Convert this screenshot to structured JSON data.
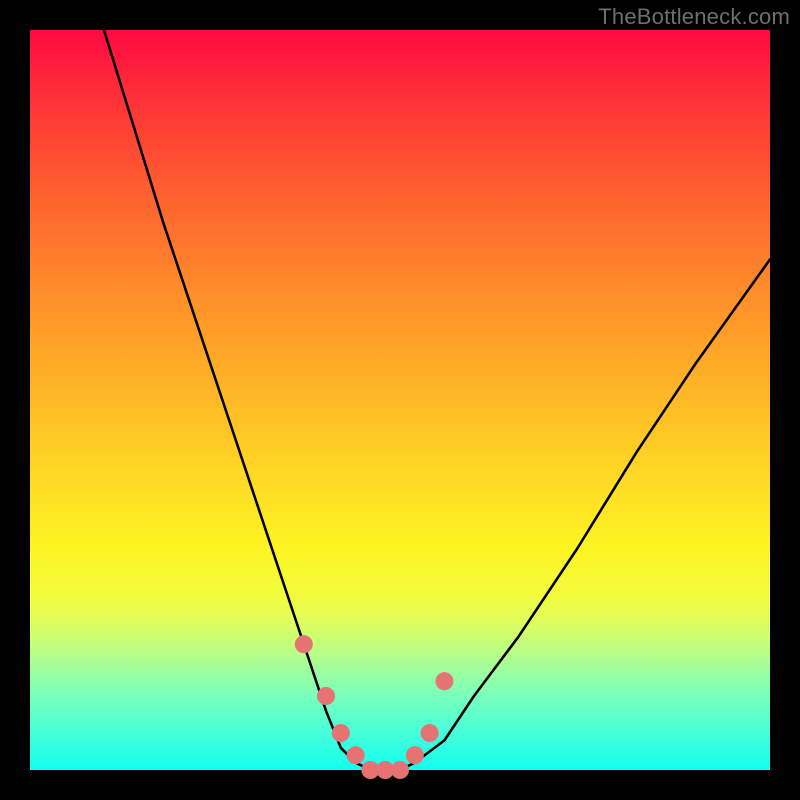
{
  "watermark": "TheBottleneck.com",
  "chart_data": {
    "type": "line",
    "title": "",
    "xlabel": "",
    "ylabel": "",
    "xlim": [
      0,
      100
    ],
    "ylim": [
      0,
      100
    ],
    "grid": false,
    "legend": false,
    "series": [
      {
        "name": "bottleneck-curve",
        "color": "#000000",
        "x": [
          10,
          14,
          18,
          22,
          26,
          30,
          34,
          36,
          38,
          40,
          42,
          44,
          46,
          48,
          50,
          52,
          56,
          60,
          66,
          74,
          82,
          90,
          100
        ],
        "y": [
          100,
          87,
          74,
          62,
          50,
          38,
          26,
          20,
          14,
          8,
          3,
          1,
          0,
          0,
          0,
          1,
          4,
          10,
          18,
          30,
          43,
          55,
          69
        ]
      }
    ],
    "markers": [
      {
        "name": "highlight-dots",
        "color": "#e57373",
        "radius": 9,
        "x": [
          37,
          40,
          42,
          44,
          46,
          48,
          50,
          52,
          54,
          56
        ],
        "y": [
          17,
          10,
          5,
          2,
          0,
          0,
          0,
          2,
          5,
          12
        ]
      }
    ],
    "gradient_stops": [
      {
        "pct": 0,
        "color": "#ff0a40"
      },
      {
        "pct": 25,
        "color": "#ff6a2e"
      },
      {
        "pct": 50,
        "color": "#ffb327"
      },
      {
        "pct": 75,
        "color": "#f4fc3a"
      },
      {
        "pct": 100,
        "color": "#12ffee"
      }
    ]
  }
}
